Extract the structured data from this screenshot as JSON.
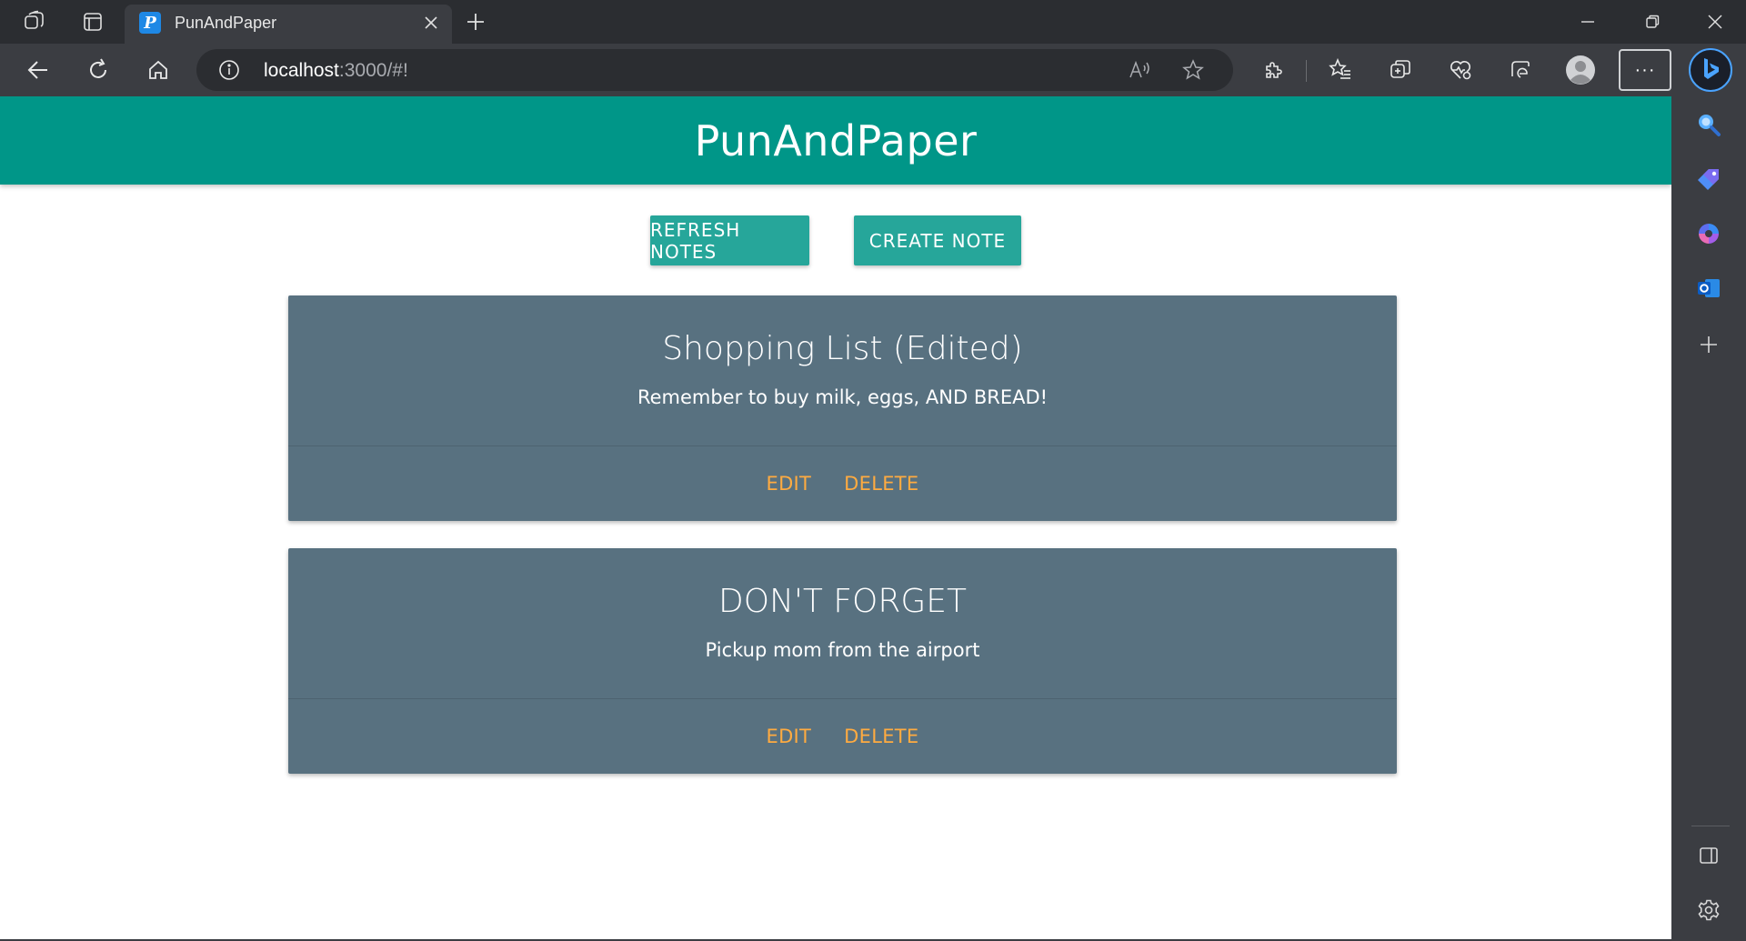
{
  "browser": {
    "tab": {
      "title": "PunAndPaper",
      "favicon_letter": "P"
    },
    "address": {
      "host": "localhost",
      "path": ":3000/#!"
    },
    "more_label": "···",
    "colors": {
      "tabbar": "#2b2d31",
      "toolbar": "#3b3d42",
      "favicon": "#1e88e5"
    }
  },
  "app": {
    "title": "PunAndPaper",
    "colors": {
      "header": "#009688",
      "button": "#26a69a",
      "card": "#587180",
      "link": "#ffab40"
    },
    "actions": {
      "refresh_label": "REFRESH NOTES",
      "create_label": "CREATE NOTE"
    },
    "notes": [
      {
        "title": "Shopping List (Edited)",
        "body": "Remember to buy milk, eggs, AND BREAD!",
        "edit_label": "EDIT",
        "delete_label": "DELETE"
      },
      {
        "title": "DON'T FORGET",
        "body": "Pickup mom from the airport",
        "edit_label": "EDIT",
        "delete_label": "DELETE"
      }
    ]
  }
}
